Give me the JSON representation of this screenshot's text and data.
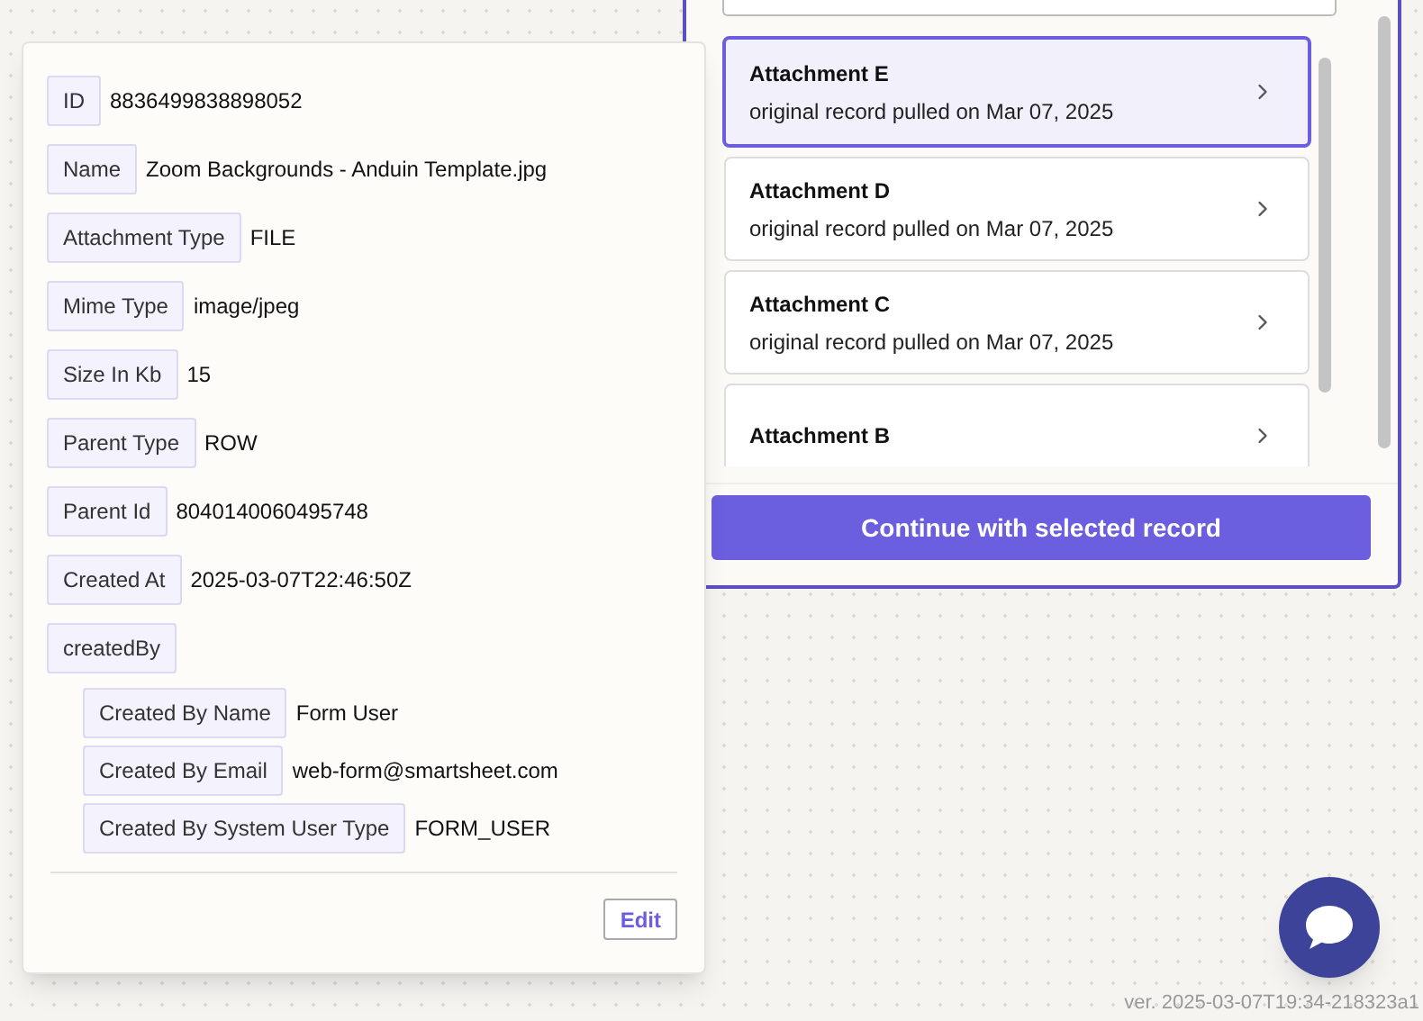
{
  "records": [
    {
      "title": "Attachment E",
      "subtitle": "original record pulled on Mar 07, 2025",
      "selected": true
    },
    {
      "title": "Attachment D",
      "subtitle": "original record pulled on Mar 07, 2025",
      "selected": false
    },
    {
      "title": "Attachment C",
      "subtitle": "original record pulled on Mar 07, 2025",
      "selected": false
    },
    {
      "title": "Attachment B",
      "selected": false
    }
  ],
  "continue_button": "Continue with selected record",
  "details": {
    "fields": [
      {
        "label": "ID",
        "value": "8836499838898052"
      },
      {
        "label": "Name",
        "value": "Zoom Backgrounds - Anduin Template.jpg"
      },
      {
        "label": "Attachment Type",
        "value": "FILE"
      },
      {
        "label": "Mime Type",
        "value": "image/jpeg"
      },
      {
        "label": "Size In Kb",
        "value": "15"
      },
      {
        "label": "Parent Type",
        "value": "ROW"
      },
      {
        "label": "Parent Id",
        "value": "8040140060495748"
      },
      {
        "label": "Created At",
        "value": "2025-03-07T22:46:50Z"
      },
      {
        "label": "createdBy",
        "children": [
          {
            "label": "Created By Name",
            "value": "Form User"
          },
          {
            "label": "Created By Email",
            "value": "web-form@smartsheet.com"
          },
          {
            "label": "Created By System User Type",
            "value": "FORM_USER"
          }
        ]
      }
    ],
    "edit_button": "Edit"
  },
  "version": "ver. 2025-03-07T19:34-218323a1"
}
